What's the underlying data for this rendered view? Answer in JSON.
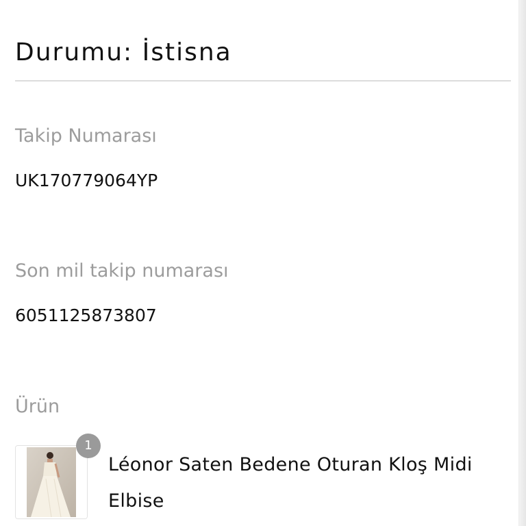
{
  "status": {
    "title": "Durumu: İstisna"
  },
  "tracking": {
    "label": "Takip Numarası",
    "value": "UK170779064YP"
  },
  "last_mile": {
    "label": "Son mil takip numarası",
    "value": "6051125873807"
  },
  "product": {
    "section_label": "Ürün",
    "name": "Léonor Saten Bedene Oturan Kloş Midi Elbise",
    "quantity": "1",
    "thumbnail_icon": "dress-product-image"
  },
  "colors": {
    "label_gray": "#9c9c9c",
    "text_dark": "#111111",
    "divider": "#dcdcdc",
    "badge": "#9a9a9a"
  }
}
